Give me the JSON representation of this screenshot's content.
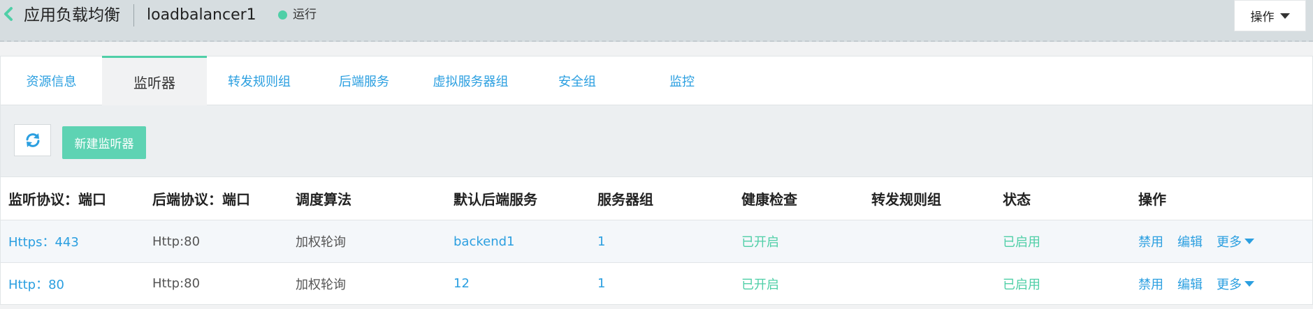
{
  "header": {
    "app_title": "应用负载均衡",
    "lb_name": "loadbalancer1",
    "status": "运行",
    "op_button": "操作"
  },
  "tabs": [
    {
      "label": "资源信息"
    },
    {
      "label": "监听器"
    },
    {
      "label": "转发规则组"
    },
    {
      "label": "后端服务"
    },
    {
      "label": "虚拟服务器组"
    },
    {
      "label": "安全组"
    },
    {
      "label": "监控"
    }
  ],
  "active_tab": "监听器",
  "toolbar": {
    "refresh_icon": "refresh-icon",
    "new_listener": "新建监听器"
  },
  "table": {
    "columns": [
      "监听协议：端口",
      "后端协议：端口",
      "调度算法",
      "默认后端服务",
      "服务器组",
      "健康检查",
      "转发规则组",
      "状态",
      "操作"
    ],
    "rows": [
      {
        "listen": "Https：443",
        "backend": "Http:80",
        "algorithm": "加权轮询",
        "default_backend": "backend1",
        "server_group": "1",
        "health": "已开启",
        "rule_group": "",
        "status": "已启用",
        "disable": "禁用",
        "edit": "编辑",
        "more": "更多"
      },
      {
        "listen": "Http：80",
        "backend": "Http:80",
        "algorithm": "加权轮询",
        "default_backend": "12",
        "server_group": "1",
        "health": "已开启",
        "rule_group": "",
        "status": "已启用",
        "disable": "禁用",
        "edit": "编辑",
        "more": "更多"
      }
    ]
  },
  "colors": {
    "accent_green": "#4fcfa7",
    "link_blue": "#2b9fe0",
    "topbar_bg": "#d6dde0"
  }
}
